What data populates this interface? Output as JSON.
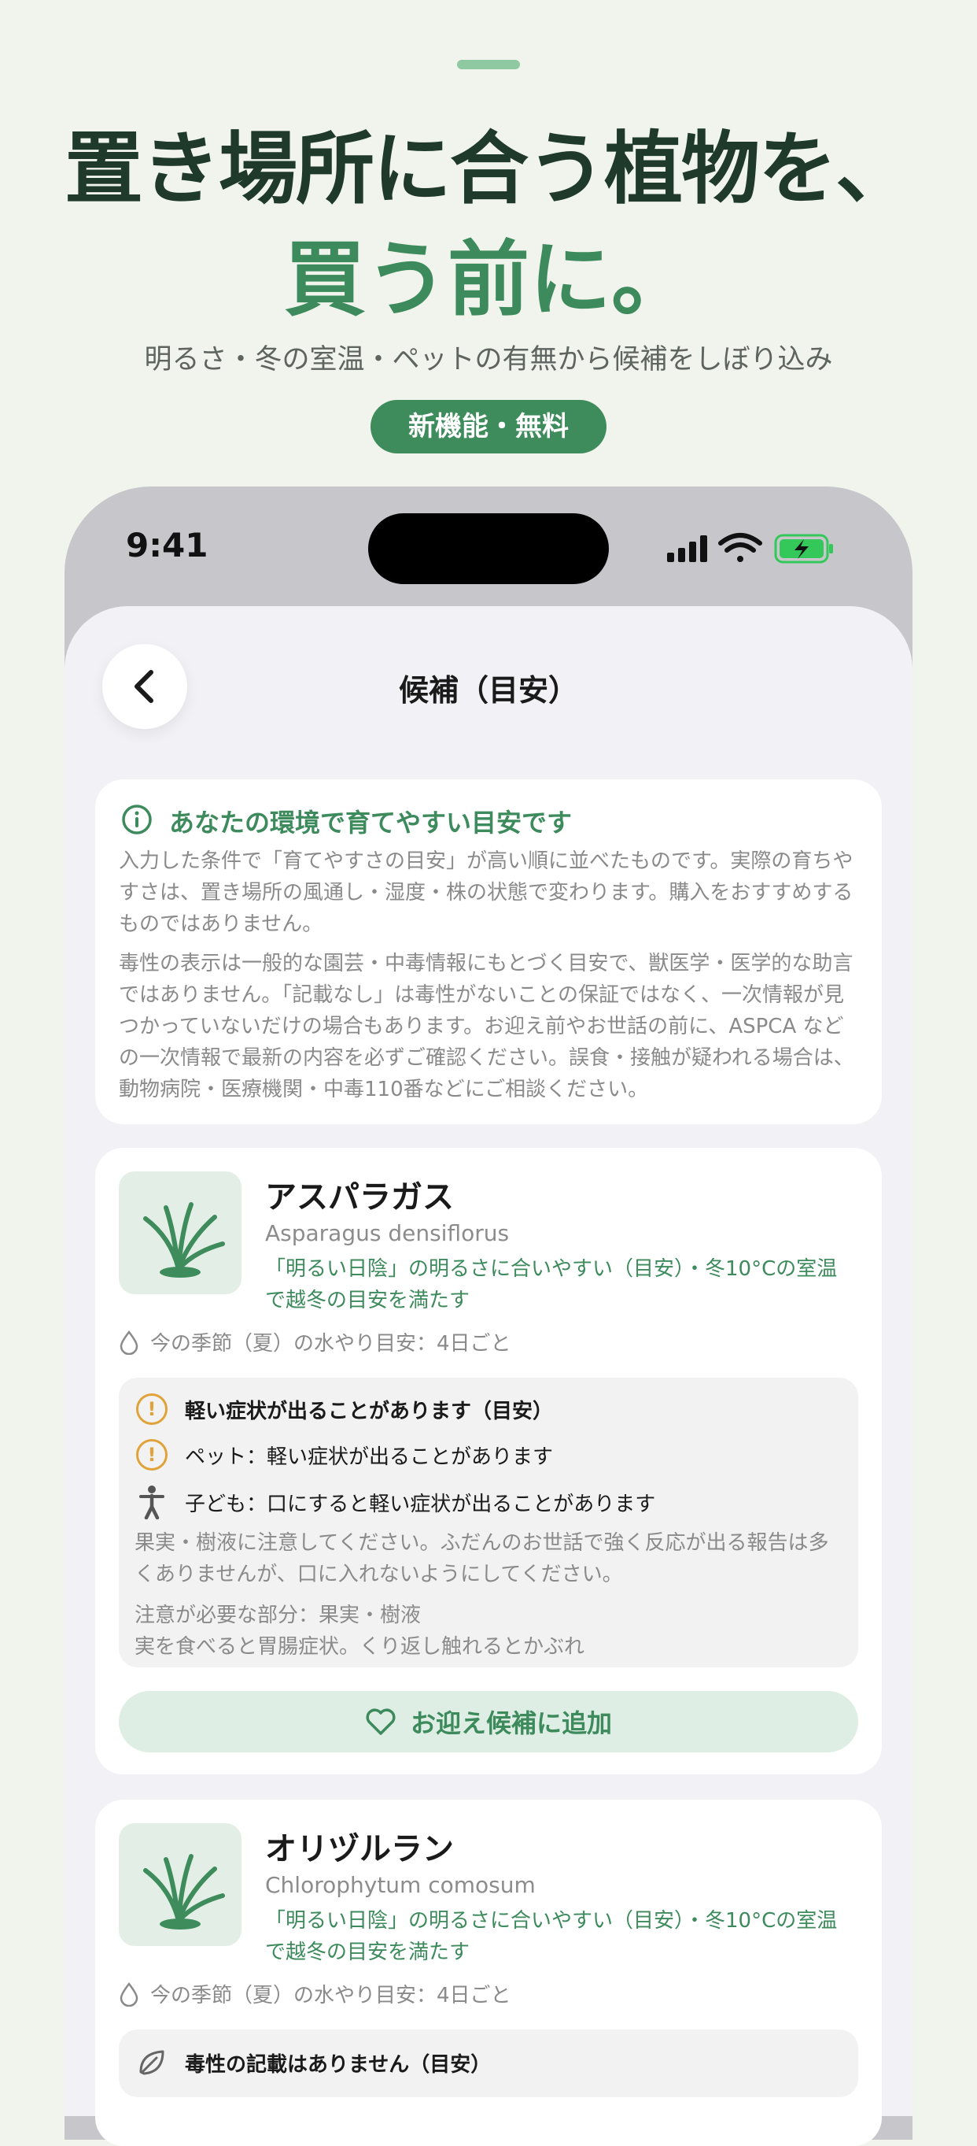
{
  "hero": {
    "headline_line1": "置き場所に合う植物を、",
    "headline_line2": "買う前に。",
    "subtitle": "明るさ・冬の室温・ペットの有無から候補をしぼり込み",
    "badge": "新機能・無料"
  },
  "status_bar": {
    "time": "9:41",
    "icons": [
      "signal-icon",
      "wifi-icon",
      "battery-charging-icon"
    ]
  },
  "nav": {
    "title": "候補（目安）",
    "back_icon": "chevron-left-icon"
  },
  "info": {
    "title": "あなたの環境で育てやすい目安です",
    "paragraph1": "入力した条件で「育てやすさの目安」が高い順に並べたものです。実際の育ちやすさは、置き場所の風通し・湿度・株の状態で変わります。購入をおすすめするものではありません。",
    "paragraph2": "毒性の表示は一般的な園芸・中毒情報にもとづく目安で、獣医学・医学的な助言ではありません。「記載なし」は毒性がないことの保証ではなく、一次情報が見つかっていないだけの場合もあります。お迎え前やお世話の前に、ASPCA などの一次情報で最新の内容を必ずご確認ください。誤食・接触が疑われる場合は、動物病院・医療機関・中毒110番などにご相談ください。"
  },
  "plants": [
    {
      "name": "アスパラガス",
      "latin": "Asparagus densiflorus",
      "fit": "「明るい日陰」の明るさに合いやすい（目安）・冬10°Cの室温で越冬の目安を満たす",
      "water": "今の季節（夏）の水やり目安：4日ごと",
      "warning_title": "軽い症状が出ることがあります（目安）",
      "pet_warning": "ペット：軽い症状が出ることがあります",
      "child_warning": "子ども：口にすると軽い症状が出ることがあります",
      "note": "果実・樹液に注意してください。ふだんのお世話で強く反応が出る報告は多くありませんが、口に入れないようにしてください。",
      "parts": "注意が必要な部分：果実・樹液",
      "symptoms": "実を食べると胃腸症状。くり返し触れるとかぶれ",
      "add_button": "お迎え候補に追加"
    },
    {
      "name": "オリヅルラン",
      "latin": "Chlorophytum comosum",
      "fit": "「明るい日陰」の明るさに合いやすい（目安）・冬10°Cの室温で越冬の目安を満たす",
      "water": "今の季節（夏）の水やり目安：4日ごと",
      "toxicity": "毒性の記載はありません（目安）"
    }
  ],
  "colors": {
    "accent": "#3d8a5c",
    "headline": "#1f3a2b",
    "warning": "#e0a33a",
    "background": "#f1f4ec"
  }
}
